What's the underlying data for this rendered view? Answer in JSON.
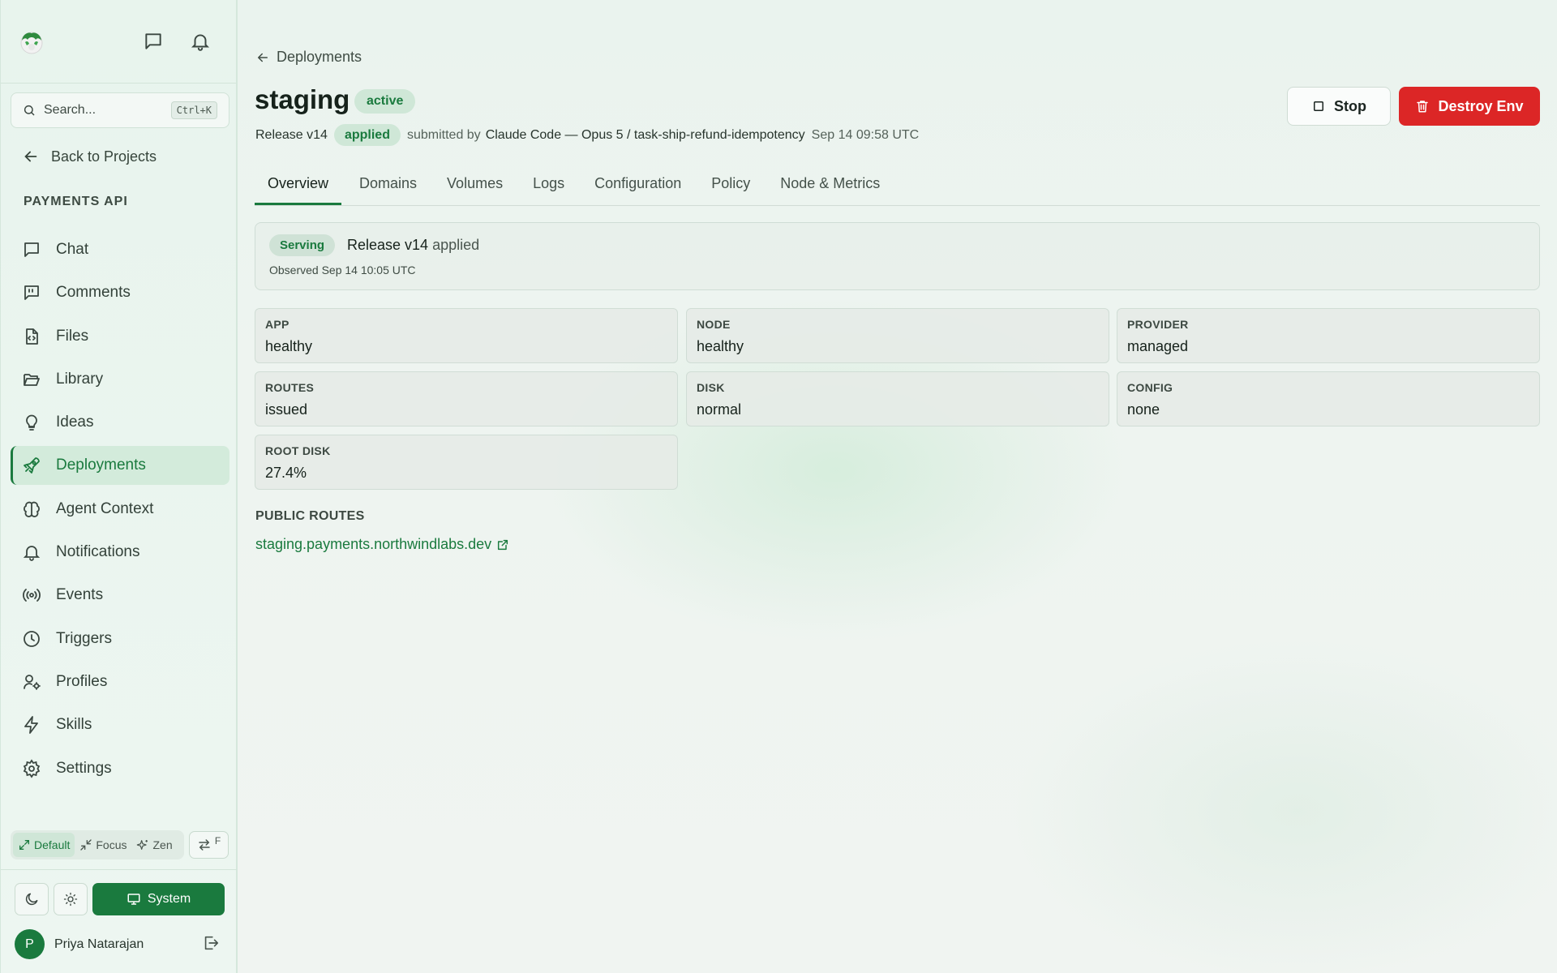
{
  "sidebar": {
    "search_placeholder": "Search...",
    "search_shortcut": "Ctrl+K",
    "back_label": "Back to Projects",
    "project_name": "PAYMENTS API",
    "items": [
      {
        "label": "Chat",
        "icon": "chat-icon"
      },
      {
        "label": "Comments",
        "icon": "comments-icon"
      },
      {
        "label": "Files",
        "icon": "file-code-icon"
      },
      {
        "label": "Library",
        "icon": "folder-open-icon"
      },
      {
        "label": "Ideas",
        "icon": "lightbulb-icon"
      },
      {
        "label": "Deployments",
        "icon": "rocket-icon",
        "active": true
      },
      {
        "label": "Agent Context",
        "icon": "brain-icon"
      },
      {
        "label": "Notifications",
        "icon": "bell-icon"
      },
      {
        "label": "Events",
        "icon": "broadcast-icon"
      },
      {
        "label": "Triggers",
        "icon": "clock-icon"
      },
      {
        "label": "Profiles",
        "icon": "user-cog-icon"
      },
      {
        "label": "Skills",
        "icon": "zap-icon"
      },
      {
        "label": "Settings",
        "icon": "gear-icon"
      }
    ],
    "modes": {
      "default": "Default",
      "focus": "Focus",
      "zen": "Zen",
      "swap_hint": "F"
    },
    "theme": {
      "system_label": "System"
    },
    "user": {
      "initial": "P",
      "name": "Priya Natarajan"
    }
  },
  "header": {
    "breadcrumb": "Deployments",
    "title": "staging",
    "status_badge": "active",
    "release": "Release v14",
    "release_badge": "applied",
    "submitted_by_label": "submitted by",
    "submitter": "Claude Code — Opus 5 / task-ship-refund-idempotency",
    "timestamp": "Sep 14 09:58 UTC",
    "stop_label": "Stop",
    "destroy_label": "Destroy Env"
  },
  "tabs": [
    "Overview",
    "Domains",
    "Volumes",
    "Logs",
    "Configuration",
    "Policy",
    "Node & Metrics"
  ],
  "status": {
    "badge": "Serving",
    "release": "Release v14",
    "state": "applied",
    "observed": "Observed Sep 14 10:05 UTC"
  },
  "health": [
    {
      "label": "APP",
      "value": "healthy"
    },
    {
      "label": "NODE",
      "value": "healthy"
    },
    {
      "label": "PROVIDER",
      "value": "managed"
    },
    {
      "label": "ROUTES",
      "value": "issued"
    },
    {
      "label": "DISK",
      "value": "normal"
    },
    {
      "label": "CONFIG",
      "value": "none"
    },
    {
      "label": "ROOT DISK",
      "value": "27.4%"
    }
  ],
  "routes": {
    "label": "PUBLIC ROUTES",
    "items": [
      "staging.payments.northwindlabs.dev"
    ]
  },
  "colors": {
    "accent": "#1a7a3e",
    "danger": "#dc2626"
  }
}
